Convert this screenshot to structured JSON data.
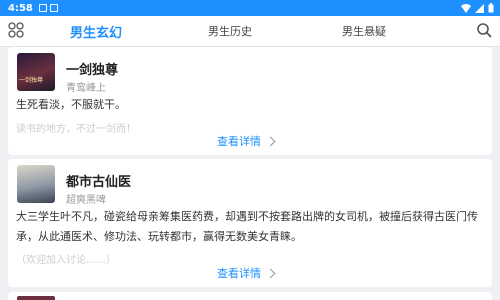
{
  "status_bar": {
    "time": "4:58"
  },
  "tabs": [
    {
      "label": "男生玄幻",
      "active": true
    },
    {
      "label": "男生历史",
      "active": false
    },
    {
      "label": "男生悬疑",
      "active": false
    }
  ],
  "cards": [
    {
      "title": "一剑独尊",
      "author": "青鸾峰上",
      "description": "生死看淡，不服就干。",
      "faded_text": "读书的地方，不过一剑而！",
      "detail_label": "查看详情",
      "cover_text": "一剑独尊"
    },
    {
      "title": "都市古仙医",
      "author": "超爽黑啤",
      "description": "大三学生叶不凡，碰瓷给母亲筹集医药费，却遇到不按套路出牌的女司机，被撞后获得古医门传承，从此通医术、修功法、玩转都市，赢得无数美女青睐。",
      "faded_text": "（欢迎加入讨论……）",
      "detail_label": "查看详情"
    }
  ],
  "colors": {
    "accent": "#1e90ff",
    "background": "#eef0f3"
  }
}
